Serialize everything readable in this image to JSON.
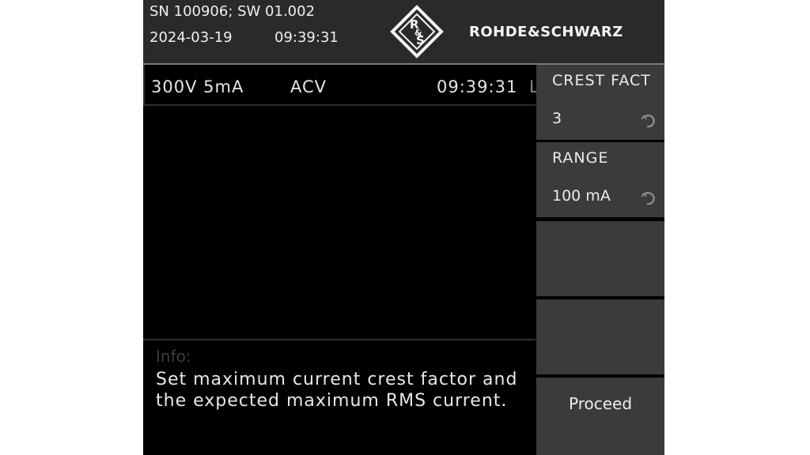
{
  "header": {
    "serial_line": "SN 100906; SW 01.002",
    "date": "2024-03-19",
    "time": "09:39:31",
    "brand": "ROHDE&SCHWARZ",
    "logo_letters": "R&S"
  },
  "status": {
    "range": "300V 5mA",
    "mode": "ACV",
    "time": "09:39:31",
    "extra": "L"
  },
  "info": {
    "title": "Info:",
    "message": "Set maximum current crest factor and the expected maximum RMS current."
  },
  "softkeys": [
    {
      "label": "CREST FACT",
      "value": "3",
      "icon": "rotary-knob-icon"
    },
    {
      "label": "RANGE",
      "value": "100 mA",
      "icon": "rotary-knob-icon"
    },
    {
      "label": ""
    },
    {
      "label": ""
    },
    {
      "label": "Proceed"
    }
  ],
  "colors": {
    "header_bg": "#2a2a2a",
    "softkey_bg": "#3b3b3b",
    "display_bg": "#000000",
    "text": "#ececec",
    "info_title": "#3e3e3e"
  }
}
